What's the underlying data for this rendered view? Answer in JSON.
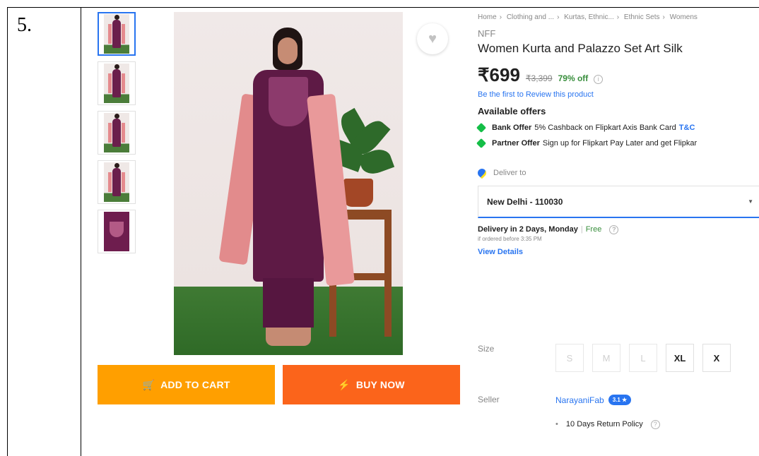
{
  "row_number": "5.",
  "breadcrumb": [
    "Home",
    "Clothing and ...",
    "Kurtas, Ethnic...",
    "Ethnic Sets",
    "Womens"
  ],
  "product": {
    "brand": "NFF",
    "title": "Women Kurta and Palazzo Set Art Silk",
    "price": "₹699",
    "mrp": "₹3,399",
    "discount": "79% off",
    "review_link": "Be the first to Review this product"
  },
  "offers": {
    "heading": "Available offers",
    "items": [
      {
        "type": "Bank Offer",
        "text": "5% Cashback on Flipkart Axis Bank Card",
        "link": "T&C"
      },
      {
        "type": "Partner Offer",
        "text": "Sign up for Flipkart Pay Later and get Flipkar",
        "link": ""
      }
    ]
  },
  "delivery": {
    "label": "Deliver to",
    "pincode": "New Delhi - 110030",
    "eta": "Delivery in 2 Days, Monday",
    "separator": "|",
    "free": "Free",
    "cutoff": "if ordered before 3:35 PM",
    "view_details": "View Details"
  },
  "sizes": {
    "label": "Size",
    "options": [
      "S",
      "M",
      "L",
      "XL",
      "X"
    ]
  },
  "seller": {
    "label": "Seller",
    "name": "NarayaniFab",
    "rating": "3.1 ★",
    "policy": "10 Days Return Policy"
  },
  "actions": {
    "add_to_cart": "ADD TO CART",
    "buy_now": "BUY NOW"
  },
  "colors": {
    "add_to_cart": "#ff9f00",
    "buy_now": "#fb641b",
    "link": "#2874f0",
    "discount": "#388e3c"
  }
}
